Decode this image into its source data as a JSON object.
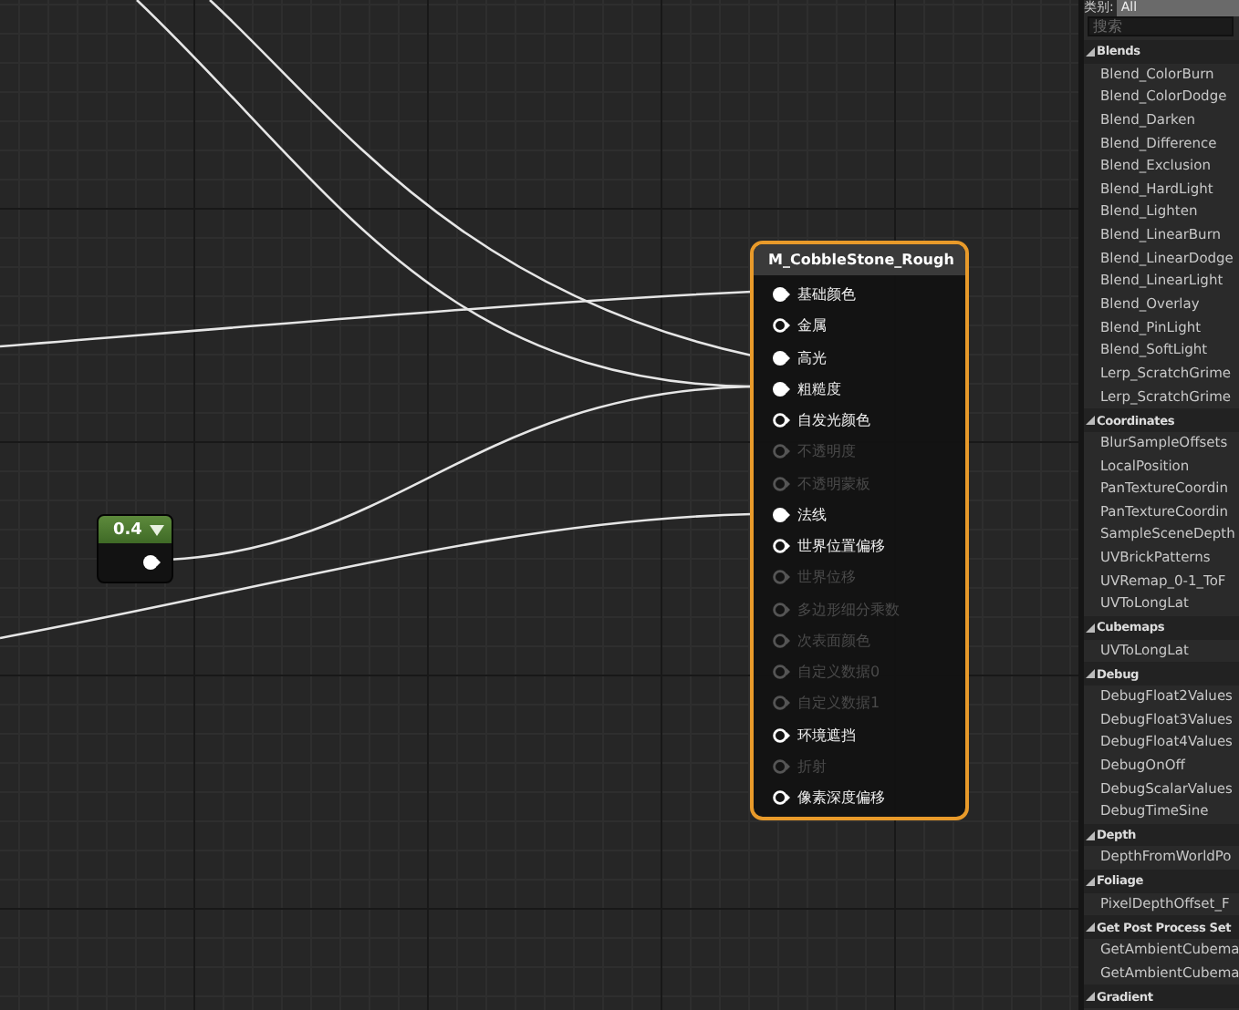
{
  "graph": {
    "constant_node": {
      "value": "0.4",
      "expanded": true
    },
    "material_node": {
      "title": "M_CobbleStone_Rough",
      "pins": [
        {
          "label": "基础颜色",
          "connected": true,
          "disabled": false
        },
        {
          "label": "金属",
          "connected": false,
          "disabled": false
        },
        {
          "label": "高光",
          "connected": true,
          "disabled": false
        },
        {
          "label": "粗糙度",
          "connected": true,
          "disabled": false
        },
        {
          "label": "自发光颜色",
          "connected": false,
          "disabled": false
        },
        {
          "label": "不透明度",
          "connected": false,
          "disabled": true
        },
        {
          "label": "不透明蒙板",
          "connected": false,
          "disabled": true
        },
        {
          "label": "法线",
          "connected": true,
          "disabled": false
        },
        {
          "label": "世界位置偏移",
          "connected": false,
          "disabled": false
        },
        {
          "label": "世界位移",
          "connected": false,
          "disabled": true
        },
        {
          "label": "多边形细分乘数",
          "connected": false,
          "disabled": true
        },
        {
          "label": "次表面颜色",
          "connected": false,
          "disabled": true
        },
        {
          "label": "自定义数据0",
          "connected": false,
          "disabled": true
        },
        {
          "label": "自定义数据1",
          "connected": false,
          "disabled": true
        },
        {
          "label": "环境遮挡",
          "connected": false,
          "disabled": false
        },
        {
          "label": "折射",
          "connected": false,
          "disabled": true
        },
        {
          "label": "像素深度偏移",
          "connected": false,
          "disabled": false
        }
      ]
    }
  },
  "palette": {
    "category_label": "类别:",
    "category_value": "All",
    "search": {
      "placeholder": "搜索"
    },
    "categories": [
      {
        "name": "Blends",
        "expanded": true,
        "children": [
          "Blend_ColorBurn",
          "Blend_ColorDodge",
          "Blend_Darken",
          "Blend_Difference",
          "Blend_Exclusion",
          "Blend_HardLight",
          "Blend_Lighten",
          "Blend_LinearBurn",
          "Blend_LinearDodge",
          "Blend_LinearLight",
          "Blend_Overlay",
          "Blend_PinLight",
          "Blend_SoftLight",
          "Lerp_ScratchGrime",
          "Lerp_ScratchGrime"
        ]
      },
      {
        "name": "Coordinates",
        "expanded": true,
        "children": [
          "BlurSampleOffsets",
          "LocalPosition",
          "PanTextureCoordin",
          "PanTextureCoordin",
          "SampleSceneDepth",
          "UVBrickPatterns",
          "UVRemap_0-1_ToF",
          "UVToLongLat"
        ]
      },
      {
        "name": "Cubemaps",
        "expanded": true,
        "children": [
          "UVToLongLat"
        ]
      },
      {
        "name": "Debug",
        "expanded": true,
        "children": [
          "DebugFloat2Values",
          "DebugFloat3Values",
          "DebugFloat4Values",
          "DebugOnOff",
          "DebugScalarValues",
          "DebugTimeSine"
        ]
      },
      {
        "name": "Depth",
        "expanded": true,
        "children": [
          "DepthFromWorldPo"
        ]
      },
      {
        "name": "Foliage",
        "expanded": true,
        "children": [
          "PixelDepthOffset_F"
        ]
      },
      {
        "name": "Get Post Process Set",
        "expanded": true,
        "children": [
          "GetAmbientCubema",
          "GetAmbientCubema"
        ]
      },
      {
        "name": "Gradient",
        "expanded": true
      }
    ]
  }
}
